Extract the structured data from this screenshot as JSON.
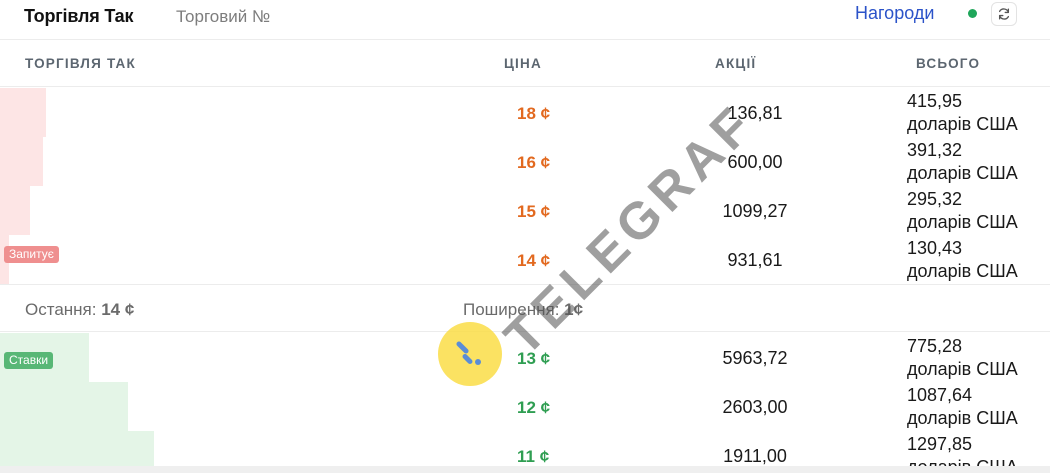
{
  "header": {
    "active_tab": "Торгівля Так",
    "inactive_tab": "Торговий №",
    "rewards_label": "Нагороди",
    "live_indicator_color": "#1fa65a",
    "refresh_icon": "refresh-icon"
  },
  "columns": {
    "side": "ТОРГІВЛЯ ТАК",
    "price": "ЦІНА",
    "shares": "АКЦІЇ",
    "total": "ВСЬОГО"
  },
  "asks_label": "Запитує",
  "bids_label": "Ставки",
  "asks": [
    {
      "price": "18 ¢",
      "shares": "136,81",
      "total_amount": "415,95",
      "total_currency": "доларів США",
      "depth": 0.044
    },
    {
      "price": "16 ¢",
      "shares": "600,00",
      "total_amount": "391,32",
      "total_currency": "доларів США",
      "depth": 0.041
    },
    {
      "price": "15 ¢",
      "shares": "1099,27",
      "total_amount": "295,32",
      "total_currency": "доларів США",
      "depth": 0.029
    },
    {
      "price": "14 ¢",
      "shares": "931,61",
      "total_amount": "130,43",
      "total_currency": "доларів США",
      "depth": 0.009
    }
  ],
  "spread": {
    "last_label": "Остання:",
    "last_value": "14 ¢",
    "spread_label": "Поширення:",
    "spread_value": "1¢"
  },
  "bids": [
    {
      "price": "13 ¢",
      "shares": "5963,72",
      "total_amount": "775,28",
      "total_currency": "доларів США",
      "depth": 0.085
    },
    {
      "price": "12 ¢",
      "shares": "2603,00",
      "total_amount": "1087,64",
      "total_currency": "доларів США",
      "depth": 0.122
    },
    {
      "price": "11 ¢",
      "shares": "1911,00",
      "total_amount": "1297,85",
      "total_currency": "доларів США",
      "depth": 0.147
    }
  ],
  "watermark": {
    "text": "TELEGRAF",
    "circle_color": "#fadd46",
    "mark_color": "#5a8dd6"
  },
  "colors": {
    "ask_price": "#e2691f",
    "bid_price": "#2f9e52",
    "ask_depth": "#fde5e5",
    "bid_depth": "#e4f5e7",
    "rewards": "#2b53c9"
  }
}
